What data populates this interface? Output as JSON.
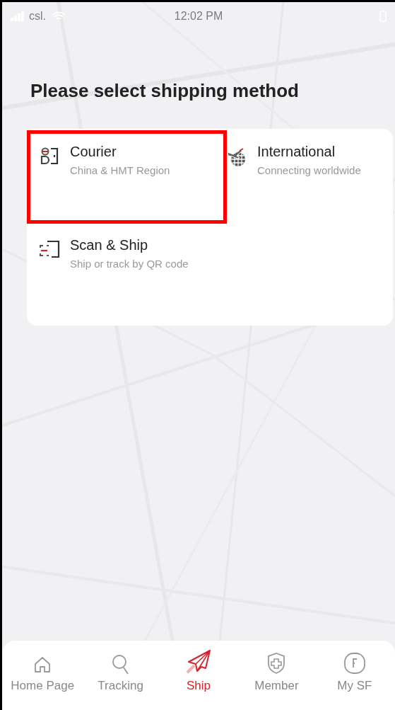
{
  "status_bar": {
    "carrier": "csl.",
    "time": "12:02 PM"
  },
  "title": "Please select shipping method",
  "options": [
    {
      "kind": "courier",
      "label": "Courier",
      "subtitle": "China & HMT Region",
      "highlighted": true
    },
    {
      "kind": "international",
      "label": "International",
      "subtitle": "Connecting worldwide",
      "highlighted": false
    },
    {
      "kind": "scan",
      "label": "Scan & Ship",
      "subtitle": "Ship or track by QR code",
      "highlighted": false
    }
  ],
  "tab_bar": [
    {
      "kind": "home",
      "label": "Home Page",
      "selected": false
    },
    {
      "kind": "tracking",
      "label": "Tracking",
      "selected": false
    },
    {
      "kind": "ship",
      "label": "Ship",
      "selected": true
    },
    {
      "kind": "member",
      "label": "Member",
      "selected": false
    },
    {
      "kind": "mysf",
      "label": "My SF",
      "selected": false
    }
  ]
}
